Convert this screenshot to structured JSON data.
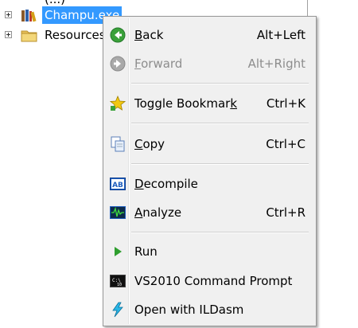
{
  "tree": {
    "partial_top_text": "(...)",
    "nodes": [
      {
        "label": "Champu.exe",
        "icon": "assembly-books-icon",
        "selected": true
      },
      {
        "label": "Resources",
        "icon": "folder-icon",
        "selected": false
      }
    ]
  },
  "menu": {
    "items": [
      {
        "pre": "",
        "u": "B",
        "post": "ack",
        "shortcut": "Alt+Left",
        "icon": "back-arrow-icon",
        "enabled": true
      },
      {
        "pre": "",
        "u": "F",
        "post": "orward",
        "shortcut": "Alt+Right",
        "icon": "forward-arrow-icon",
        "enabled": false
      },
      {
        "pre": "Toggle Bookmar",
        "u": "k",
        "post": "",
        "shortcut": "Ctrl+K",
        "icon": "bookmark-star-icon",
        "enabled": true
      },
      {
        "pre": "",
        "u": "C",
        "post": "opy",
        "shortcut": "Ctrl+C",
        "icon": "copy-icon",
        "enabled": true
      },
      {
        "pre": "",
        "u": "D",
        "post": "ecompile",
        "shortcut": "",
        "icon": "decompile-ab-icon",
        "enabled": true
      },
      {
        "pre": "",
        "u": "A",
        "post": "nalyze",
        "shortcut": "Ctrl+R",
        "icon": "analyze-waveform-icon",
        "enabled": true
      },
      {
        "pre": "Run",
        "u": "",
        "post": "",
        "shortcut": "",
        "icon": "run-play-icon",
        "enabled": true
      },
      {
        "pre": "VS2010 Command Prompt",
        "u": "",
        "post": "",
        "shortcut": "",
        "icon": "command-prompt-icon",
        "enabled": true
      },
      {
        "pre": "Open with ILDasm",
        "u": "",
        "post": "",
        "shortcut": "",
        "icon": "ildasm-bolt-icon",
        "enabled": true
      }
    ]
  },
  "colors": {
    "selection": "#3399ff",
    "menu_background": "#f0f0f0",
    "disabled_text": "#8d8d8d",
    "back_icon_green": "#3aa13a",
    "run_icon_green": "#2e9e2e"
  }
}
